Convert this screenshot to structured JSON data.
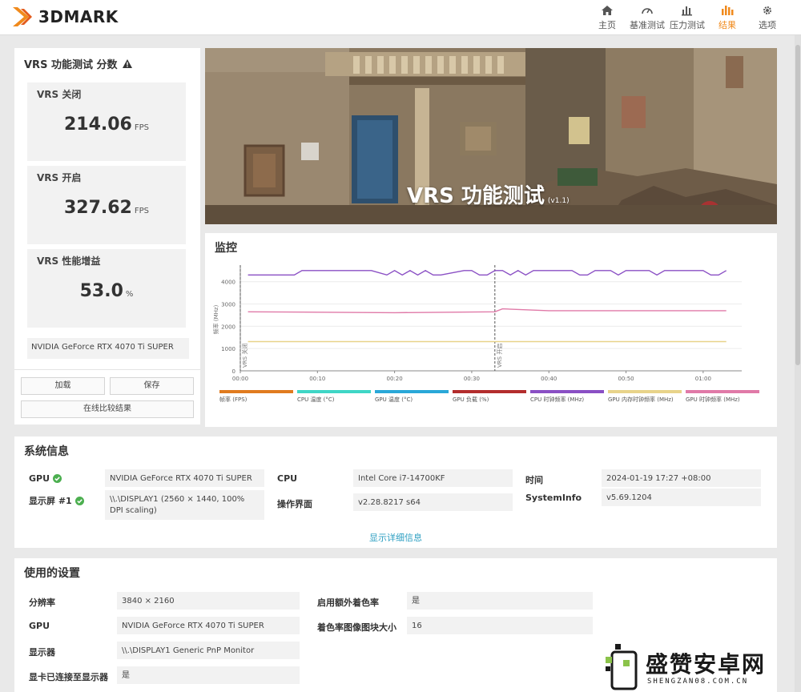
{
  "app": {
    "logo_text": "3DMARK"
  },
  "nav": [
    {
      "label": "主页",
      "icon": "home-icon"
    },
    {
      "label": "基准测试",
      "icon": "gauge-icon"
    },
    {
      "label": "压力测试",
      "icon": "bars-icon"
    },
    {
      "label": "结果",
      "icon": "results-icon",
      "active": true
    },
    {
      "label": "选项",
      "icon": "gear-icon"
    }
  ],
  "score": {
    "title": "VRS 功能测试 分数",
    "off": {
      "label": "VRS 关闭",
      "value": "214.06",
      "unit": "FPS"
    },
    "on": {
      "label": "VRS 开启",
      "value": "327.62",
      "unit": "FPS"
    },
    "gain": {
      "label": "VRS 性能增益",
      "value": "53.0",
      "unit": "%"
    },
    "gpu": "NVIDIA GeForce RTX 4070 Ti SUPER",
    "load_label": "加载",
    "save_label": "保存",
    "compare_label": "在线比较结果"
  },
  "hero": {
    "title": "VRS 功能测试",
    "version": "(v1.1)"
  },
  "monitor": {
    "title": "监控",
    "legend": [
      {
        "label": "帧率 (FPS)",
        "color": "#e07b1f"
      },
      {
        "label": "CPU 温度 (°C)",
        "color": "#3fd6c6"
      },
      {
        "label": "GPU 温度 (°C)",
        "color": "#2aa8d8"
      },
      {
        "label": "GPU 负载 (%)",
        "color": "#b32d2d"
      },
      {
        "label": "CPU 时钟频率 (MHz)",
        "color": "#8a4fc4"
      },
      {
        "label": "GPU 内存时钟频率 (MHz)",
        "color": "#e8d38a"
      },
      {
        "label": "GPU 时钟频率 (MHz)",
        "color": "#e07aa8"
      }
    ]
  },
  "chart_data": {
    "type": "line",
    "ylabel": "频率 (MHz)",
    "ylim": [
      0,
      4600
    ],
    "yticks": [
      "0",
      "1000",
      "2000",
      "3000",
      "4000"
    ],
    "xticks": [
      "00:00",
      "00:10",
      "00:20",
      "00:30",
      "00:40",
      "00:50",
      "01:00"
    ],
    "markers": [
      {
        "label": "VRS 关闭",
        "x": 0
      },
      {
        "label": "VRS 开启",
        "x": 33
      }
    ],
    "series": [
      {
        "name": "CPU 时钟频率 (MHz)",
        "color": "#8a4fc4",
        "x": [
          1,
          7,
          8,
          9,
          14,
          17,
          19,
          20,
          21,
          22,
          23,
          24,
          25,
          26,
          29,
          30,
          31,
          32,
          33,
          34,
          35,
          36,
          37,
          38,
          43,
          44,
          45,
          46,
          48,
          49,
          50,
          51,
          53,
          54,
          55,
          56,
          57,
          59,
          60,
          61,
          62,
          63
        ],
        "y": [
          4300,
          4300,
          4500,
          4500,
          4500,
          4500,
          4300,
          4500,
          4300,
          4500,
          4300,
          4500,
          4300,
          4300,
          4500,
          4500,
          4300,
          4300,
          4500,
          4500,
          4300,
          4500,
          4300,
          4500,
          4500,
          4300,
          4300,
          4500,
          4500,
          4300,
          4500,
          4500,
          4500,
          4300,
          4500,
          4500,
          4500,
          4500,
          4500,
          4300,
          4300,
          4500
        ]
      },
      {
        "name": "GPU 时钟频率 (MHz)",
        "color": "#e07aa8",
        "x": [
          1,
          10,
          20,
          33,
          34,
          40,
          50,
          63
        ],
        "y": [
          2650,
          2630,
          2610,
          2650,
          2780,
          2700,
          2700,
          2700
        ]
      },
      {
        "name": "GPU 内存时钟频率 (MHz)",
        "color": "#e8d38a",
        "x": [
          1,
          63
        ],
        "y": [
          1313,
          1313
        ]
      }
    ]
  },
  "system": {
    "title": "系统信息",
    "gpu_label": "GPU",
    "gpu_value": "NVIDIA GeForce RTX 4070 Ti SUPER",
    "display_label": "显示屏 #1",
    "display_value": "\\\\.\\DISPLAY1 (2560 × 1440, 100% DPI scaling)",
    "cpu_label": "CPU",
    "cpu_value": "Intel Core i7-14700KF",
    "ui_label": "操作界面",
    "ui_value": "v2.28.8217 s64",
    "time_label": "时间",
    "time_value": "2024-01-19 17:27 +08:00",
    "sysinfo_label": "SystemInfo",
    "sysinfo_value": "v5.69.1204",
    "detail_link": "显示详细信息"
  },
  "settings": {
    "title": "使用的设置",
    "resolution_label": "分辨率",
    "resolution_value": "3840 × 2160",
    "gpu_label": "GPU",
    "gpu_value": "NVIDIA GeForce RTX 4070 Ti SUPER",
    "display_label": "显示器",
    "display_value": "\\\\.\\DISPLAY1 Generic PnP Monitor",
    "connected_label": "显卡已连接至显示器",
    "connected_value": "是",
    "extra_shading_label": "启用额外着色率",
    "extra_shading_value": "是",
    "tile_size_label": "着色率图像图块大小",
    "tile_size_value": "16"
  },
  "watermark": {
    "text": "盛赞安卓网",
    "sub": "SHENGZAN08.COM.CN"
  }
}
